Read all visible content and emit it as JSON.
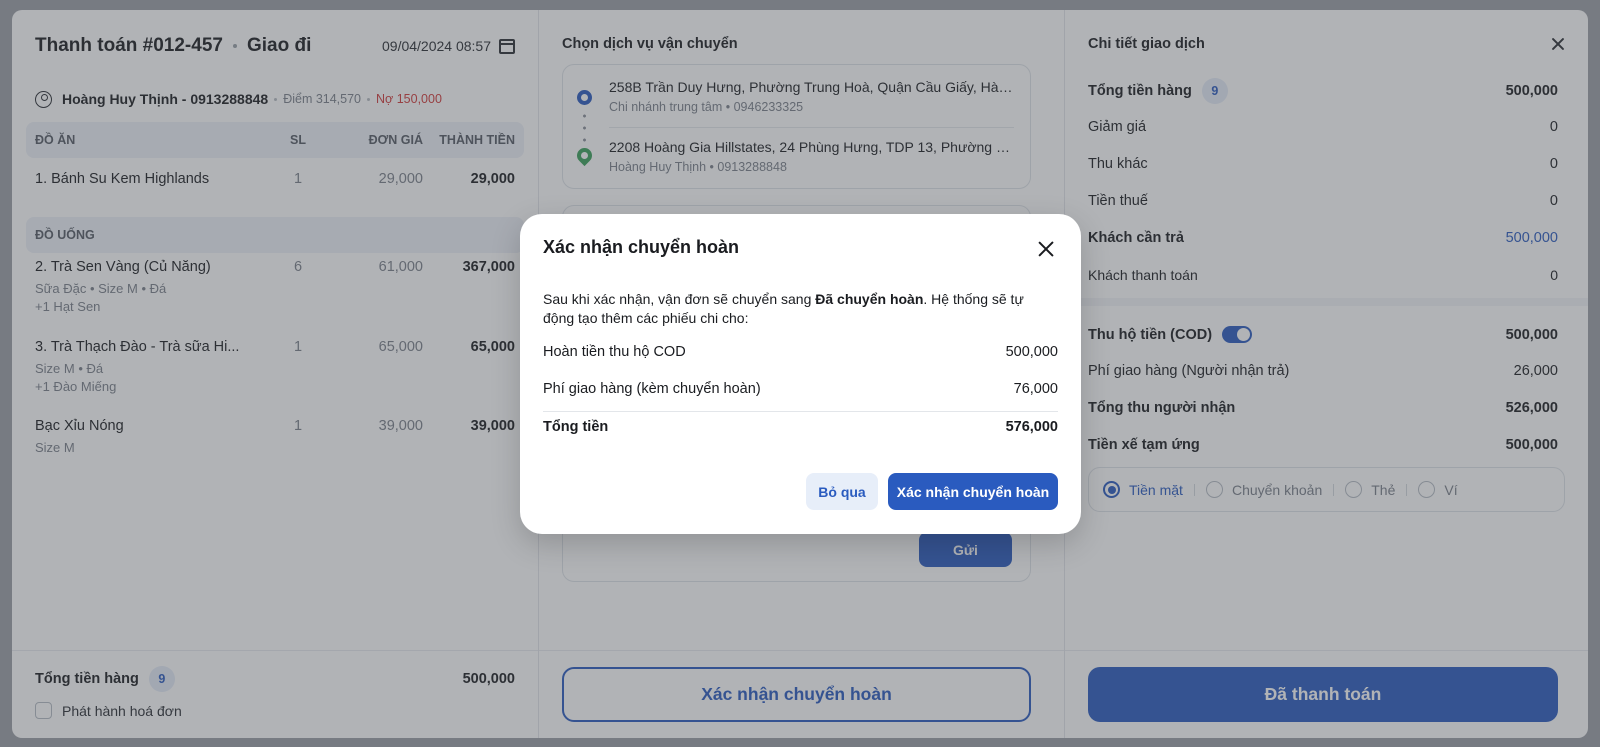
{
  "payment": {
    "title": "Thanh toán #012-457",
    "type": "Giao đi",
    "datetime": "09/04/2024 08:57",
    "customer": {
      "name": "Hoàng Huy Thịnh - 0913288848",
      "points": "Điểm 314,570",
      "debt": "Nợ 150,000"
    },
    "table_headers": [
      "ĐỒ ĂN",
      "SL",
      "ĐƠN GIÁ",
      "THÀNH TIỀN"
    ],
    "food_items": [
      {
        "name": "1. Bánh Su Kem Highlands",
        "qty": "1",
        "price": "29,000",
        "total": "29,000"
      }
    ],
    "drinks_header": "ĐỒ UỐNG",
    "drink_items": [
      {
        "name": "2. Trà Sen Vàng (Củ Năng)",
        "options": "Sữa Đặc • Size M • Đá",
        "extra": "+1 Hạt Sen",
        "qty": "6",
        "price": "61,000",
        "total": "367,000"
      },
      {
        "name": "3. Trà Thạch Đào - Trà sữa Hi...",
        "options": "Size M • Đá",
        "extra": "+1 Đào Miếng",
        "qty": "1",
        "price": "65,000",
        "total": "65,000"
      },
      {
        "name": "Bạc Xỉu Nóng",
        "options": "Size M",
        "extra": "",
        "qty": "1",
        "price": "39,000",
        "total": "39,000"
      }
    ],
    "footer": {
      "total_label": "Tổng tiền hàng",
      "total_count": "9",
      "total_amount": "500,000",
      "invoice_label": "Phát hành hoá đơn"
    }
  },
  "shipping": {
    "title": "Chọn dịch vụ vận chuyển",
    "pickup": {
      "address": "258B Trần Duy Hưng, Phường Trung Hoà, Quận Cầu Giấy, Hà Nội",
      "contact": "Chi nhánh trung tâm • 0946233325"
    },
    "dropoff": {
      "address": "2208 Hoàng Gia Hillstates, 24 Phùng Hưng, TDP 13, Phường Qua...",
      "contact": "Hoàng Huy Thịnh • 0913288848"
    },
    "send_label": "Gửi",
    "confirm_return_label": "Xác nhận chuyển hoàn"
  },
  "details": {
    "title": "Chi tiết giao dịch",
    "goods_total_label": "Tổng tiền hàng",
    "goods_total_count": "9",
    "goods_total": "500,000",
    "discount_label": "Giảm giá",
    "discount": "0",
    "other_label": "Thu khác",
    "other": "0",
    "tax_label": "Tiền thuế",
    "tax": "0",
    "payable_label": "Khách cần trả",
    "payable": "500,000",
    "paid_label": "Khách thanh toán",
    "paid": "0",
    "cod_label": "Thu hộ tiền (COD)",
    "cod": "500,000",
    "ship_fee_label": "Phí giao hàng (Người nhận trả)",
    "ship_fee": "26,000",
    "receiver_total_label": "Tổng thu người nhận",
    "receiver_total": "526,000",
    "advance_label": "Tiền xế tạm ứng",
    "advance": "500,000",
    "methods": [
      "Tiền mặt",
      "Chuyển khoản",
      "Thẻ",
      "Ví"
    ],
    "selected_method": "Tiền mặt",
    "paid_button": "Đã thanh toán"
  },
  "modal": {
    "title": "Xác nhận chuyển hoàn",
    "desc_pre": "Sau khi xác nhận, vận đơn sẽ chuyển sang ",
    "desc_bold": "Đã chuyển hoàn",
    "desc_post": ". Hệ thống sẽ tự động tạo thêm các phiếu chi cho:",
    "rows": [
      {
        "label": "Hoàn tiền thu hộ COD",
        "value": "500,000"
      },
      {
        "label": "Phí giao hàng (kèm chuyển hoàn)",
        "value": "76,000"
      }
    ],
    "total_label": "Tổng tiền",
    "total_value": "576,000",
    "cancel_label": "Bỏ qua",
    "confirm_label": "Xác nhận chuyển hoàn"
  },
  "colors": {
    "accent": "#2a5bbf",
    "debt": "#d23a3a",
    "pickup_pin": "#2a5bbf",
    "dropoff_pin": "#3aa05a"
  }
}
